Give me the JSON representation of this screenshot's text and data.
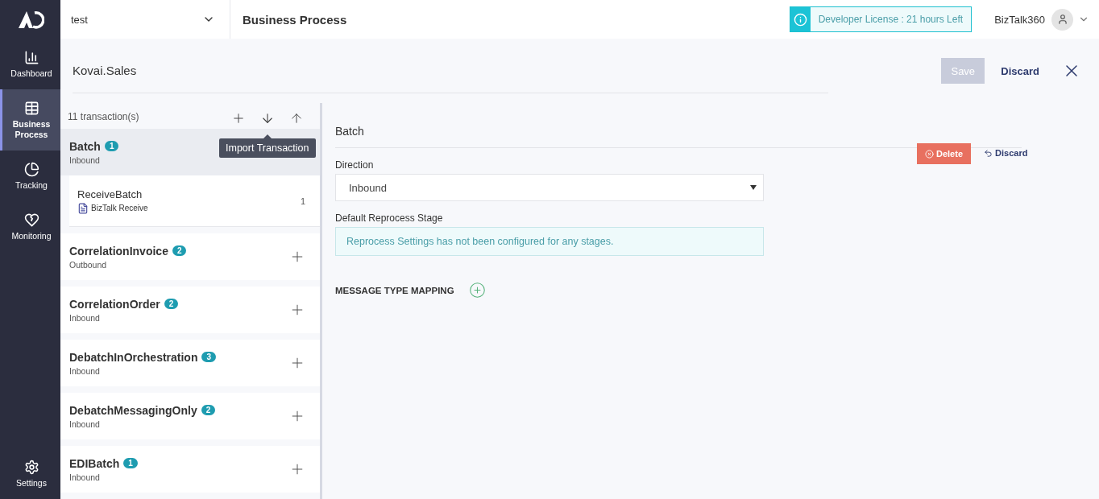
{
  "sidebar": {
    "items": [
      {
        "label": "Dashboard",
        "selected": false
      },
      {
        "label": "Business Process",
        "selected": true
      },
      {
        "label": "Tracking",
        "selected": false
      },
      {
        "label": "Monitoring",
        "selected": false
      }
    ],
    "footer": {
      "label": "Settings"
    }
  },
  "topbar": {
    "environment": "test",
    "title": "Business Process",
    "license": "Developer License : 21 hours Left",
    "user": "BizTalk360"
  },
  "header": {
    "name": "Kovai.Sales",
    "save": {
      "label": "Save",
      "disabled": true
    },
    "discard": "Discard"
  },
  "transactions": {
    "count": "11 transaction(s)",
    "tooltip": "Import Transaction",
    "items": [
      {
        "name": "Batch",
        "badge": "1",
        "direction": "Inbound",
        "selected": true,
        "children": [
          {
            "name": "ReceiveBatch",
            "type": "BizTalk Receive",
            "count": "1"
          }
        ]
      },
      {
        "name": "CorrelationInvoice",
        "badge": "2",
        "direction": "Outbound",
        "selected": false
      },
      {
        "name": "CorrelationOrder",
        "badge": "2",
        "direction": "Inbound",
        "selected": false
      },
      {
        "name": "DebatchInOrchestration",
        "badge": "3",
        "direction": "Inbound",
        "selected": false
      },
      {
        "name": "DebatchMessagingOnly",
        "badge": "2",
        "direction": "Inbound",
        "selected": false
      },
      {
        "name": "EDIBatch",
        "badge": "1",
        "direction": "Inbound",
        "selected": false
      }
    ]
  },
  "detail": {
    "title": "Batch",
    "delete": "Delete",
    "discard": "Discard",
    "direction_label": "Direction",
    "direction_value": "Inbound",
    "reprocess_label": "Default Reprocess Stage",
    "reprocess_message": "Reprocess Settings has not been configured for any stages.",
    "mapping_label": "MESSAGE TYPE MAPPING"
  }
}
